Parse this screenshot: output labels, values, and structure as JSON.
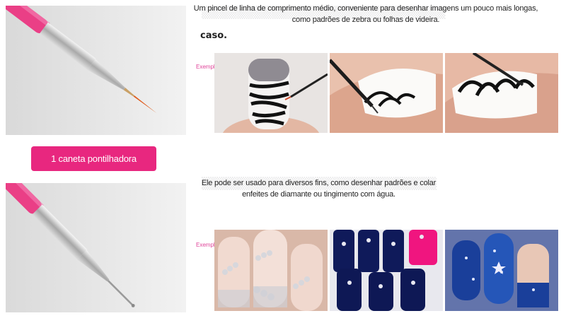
{
  "section1": {
    "description": "Um pincel de linha de comprimento médio, conveniente para desenhar imagens um pouco mais longas, como padrões de zebra ou folhas de videira.",
    "heading_fragment": "caso.",
    "example_label": "Exemplo"
  },
  "badge": {
    "label": "1 caneta pontilhadora"
  },
  "section2": {
    "description": "Ele pode ser usado para diversos fins, como desenhar padrões e colar enfeites de diamante ou tingimento com água.",
    "example_label": "Exemplo"
  },
  "colors": {
    "accent": "#e8277f",
    "brush_pink": "#ea3f86",
    "photo_bg": "#eeeeee"
  }
}
